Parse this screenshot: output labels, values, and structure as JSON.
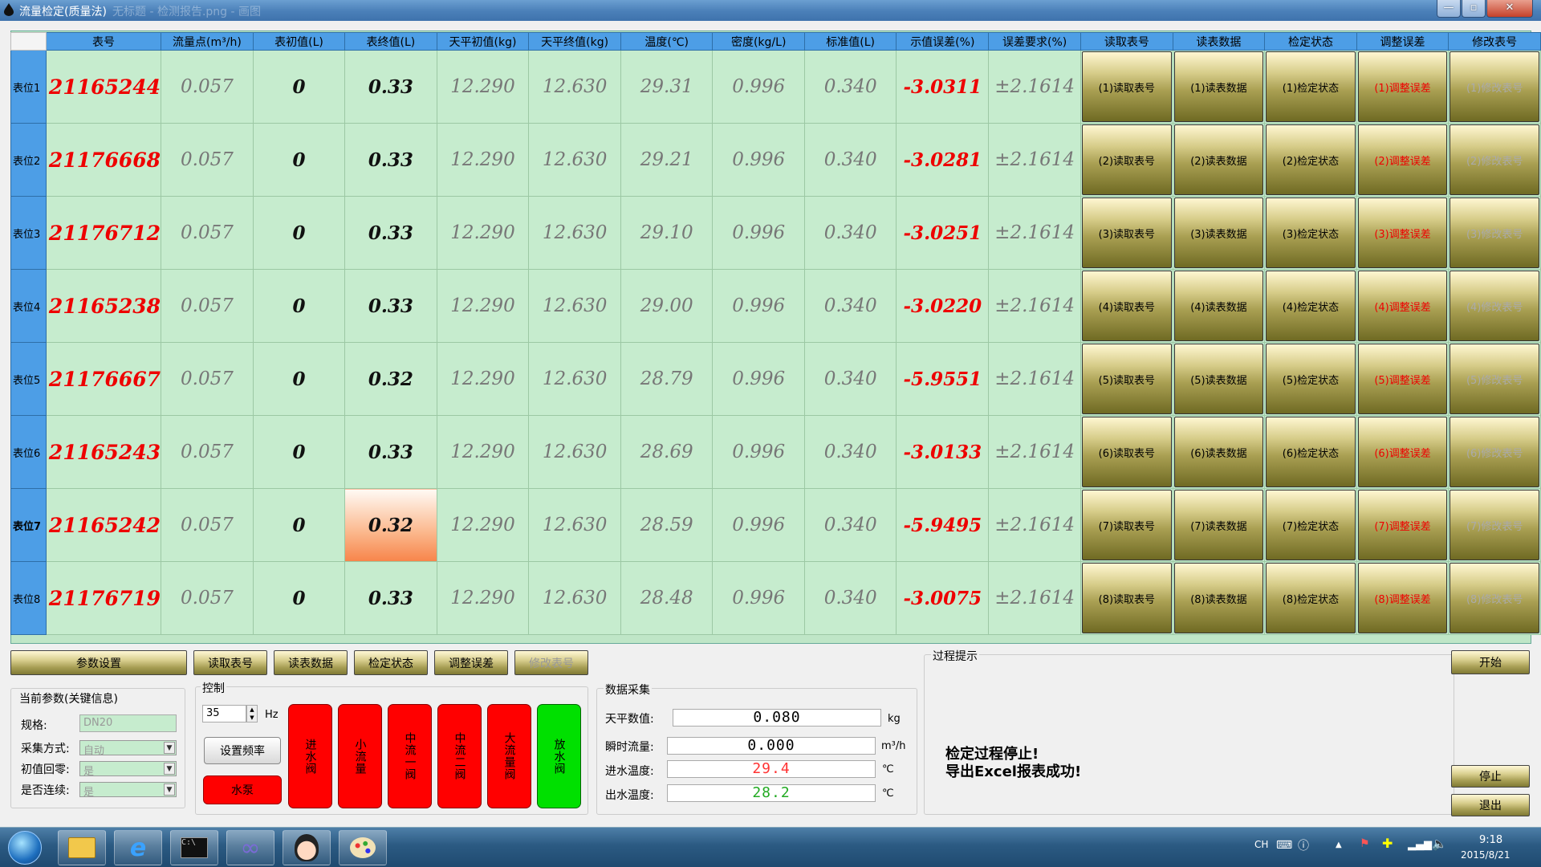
{
  "window": {
    "title": "流量检定(质量法)",
    "ghost_title": "无标题 - 检测报告.png - 画图",
    "min": "—",
    "max": "▫",
    "close": "✕"
  },
  "grid": {
    "headers": [
      "表号",
      "流量点(m³/h)",
      "表初值(L)",
      "表终值(L)",
      "天平初值(kg)",
      "天平终值(kg)",
      "温度(℃)",
      "密度(kg/L)",
      "标准值(L)",
      "示值误差(%)",
      "误差要求(%)",
      "读取表号",
      "读表数据",
      "检定状态",
      "调整误差",
      "修改表号"
    ],
    "rows": [
      {
        "label": "表位1",
        "meter": "21165244",
        "flow": "0.057",
        "init": "0",
        "final": "0.33",
        "bal_init": "12.290",
        "bal_final": "12.630",
        "temp": "29.31",
        "density": "0.996",
        "std": "0.340",
        "err": "-3.0311",
        "req": "±2.1614",
        "b1": "(1)读取表号",
        "b2": "(1)读表数据",
        "b3": "(1)检定状态",
        "b4": "(1)调整误差",
        "b5": "(1)修改表号"
      },
      {
        "label": "表位2",
        "meter": "21176668",
        "flow": "0.057",
        "init": "0",
        "final": "0.33",
        "bal_init": "12.290",
        "bal_final": "12.630",
        "temp": "29.21",
        "density": "0.996",
        "std": "0.340",
        "err": "-3.0281",
        "req": "±2.1614",
        "b1": "(2)读取表号",
        "b2": "(2)读表数据",
        "b3": "(2)检定状态",
        "b4": "(2)调整误差",
        "b5": "(2)修改表号"
      },
      {
        "label": "表位3",
        "meter": "21176712",
        "flow": "0.057",
        "init": "0",
        "final": "0.33",
        "bal_init": "12.290",
        "bal_final": "12.630",
        "temp": "29.10",
        "density": "0.996",
        "std": "0.340",
        "err": "-3.0251",
        "req": "±2.1614",
        "b1": "(3)读取表号",
        "b2": "(3)读表数据",
        "b3": "(3)检定状态",
        "b4": "(3)调整误差",
        "b5": "(3)修改表号"
      },
      {
        "label": "表位4",
        "meter": "21165238",
        "flow": "0.057",
        "init": "0",
        "final": "0.33",
        "bal_init": "12.290",
        "bal_final": "12.630",
        "temp": "29.00",
        "density": "0.996",
        "std": "0.340",
        "err": "-3.0220",
        "req": "±2.1614",
        "b1": "(4)读取表号",
        "b2": "(4)读表数据",
        "b3": "(4)检定状态",
        "b4": "(4)调整误差",
        "b5": "(4)修改表号"
      },
      {
        "label": "表位5",
        "meter": "21176667",
        "flow": "0.057",
        "init": "0",
        "final": "0.32",
        "bal_init": "12.290",
        "bal_final": "12.630",
        "temp": "28.79",
        "density": "0.996",
        "std": "0.340",
        "err": "-5.9551",
        "req": "±2.1614",
        "b1": "(5)读取表号",
        "b2": "(5)读表数据",
        "b3": "(5)检定状态",
        "b4": "(5)调整误差",
        "b5": "(5)修改表号"
      },
      {
        "label": "表位6",
        "meter": "21165243",
        "flow": "0.057",
        "init": "0",
        "final": "0.33",
        "bal_init": "12.290",
        "bal_final": "12.630",
        "temp": "28.69",
        "density": "0.996",
        "std": "0.340",
        "err": "-3.0133",
        "req": "±2.1614",
        "b1": "(6)读取表号",
        "b2": "(6)读表数据",
        "b3": "(6)检定状态",
        "b4": "(6)调整误差",
        "b5": "(6)修改表号"
      },
      {
        "label": "表位7",
        "meter": "21165242",
        "flow": "0.057",
        "init": "0",
        "final": "0.32",
        "bal_init": "12.290",
        "bal_final": "12.630",
        "temp": "28.59",
        "density": "0.996",
        "std": "0.340",
        "err": "-5.9495",
        "req": "±2.1614",
        "b1": "(7)读取表号",
        "b2": "(7)读表数据",
        "b3": "(7)检定状态",
        "b4": "(7)调整误差",
        "b5": "(7)修改表号",
        "highlight": true
      },
      {
        "label": "表位8",
        "meter": "21176719",
        "flow": "0.057",
        "init": "0",
        "final": "0.33",
        "bal_init": "12.290",
        "bal_final": "12.630",
        "temp": "28.48",
        "density": "0.996",
        "std": "0.340",
        "err": "-3.0075",
        "req": "±2.1614",
        "b1": "(8)读取表号",
        "b2": "(8)读表数据",
        "b3": "(8)检定状态",
        "b4": "(8)调整误差",
        "b5": "(8)修改表号"
      }
    ]
  },
  "actions": {
    "params": "参数设置",
    "read_no": "读取表号",
    "read_data": "读表数据",
    "status": "检定状态",
    "adjust": "调整误差",
    "modify": "修改表号"
  },
  "params": {
    "title": "当前参数(关键信息)",
    "spec_label": "规格:",
    "spec_value": "DN20",
    "mode_label": "采集方式:",
    "mode_value": "自动",
    "zero_label": "初值回零:",
    "zero_value": "是",
    "cont_label": "是否连续:",
    "cont_value": "是"
  },
  "control": {
    "title": "控制",
    "freq": "35",
    "freq_unit": "Hz",
    "set_freq": "设置频率",
    "pump": "水泵",
    "valves": [
      "进水阀",
      "小流量",
      "中流一阀",
      "中流二阀",
      "大流量阀",
      "放水阀"
    ]
  },
  "acquisition": {
    "title": "数据采集",
    "balance_label": "天平数值:",
    "balance_value": "0.080",
    "balance_unit": "kg",
    "flow_label": "瞬时流量:",
    "flow_value": "0.000",
    "flow_unit": "m³/h",
    "in_label": "进水温度:",
    "in_value": "29.4",
    "in_unit": "℃",
    "out_label": "出水温度:",
    "out_value": "28.2",
    "out_unit": "℃"
  },
  "process": {
    "title": "过程提示",
    "line1": "检定过程停止!",
    "line2": "导出Excel报表成功!"
  },
  "side": {
    "start": "开始",
    "stop": "停止",
    "exit": "退出"
  },
  "taskbar": {
    "lang": "CH",
    "time": "9:18",
    "date": "2015/8/21"
  },
  "colors": {
    "grid_bg": "#c6ecce",
    "header_blue": "#4d9ee6",
    "error_red": "#ee0000",
    "valve_red": "#ff0000",
    "valve_green": "#00e000"
  }
}
